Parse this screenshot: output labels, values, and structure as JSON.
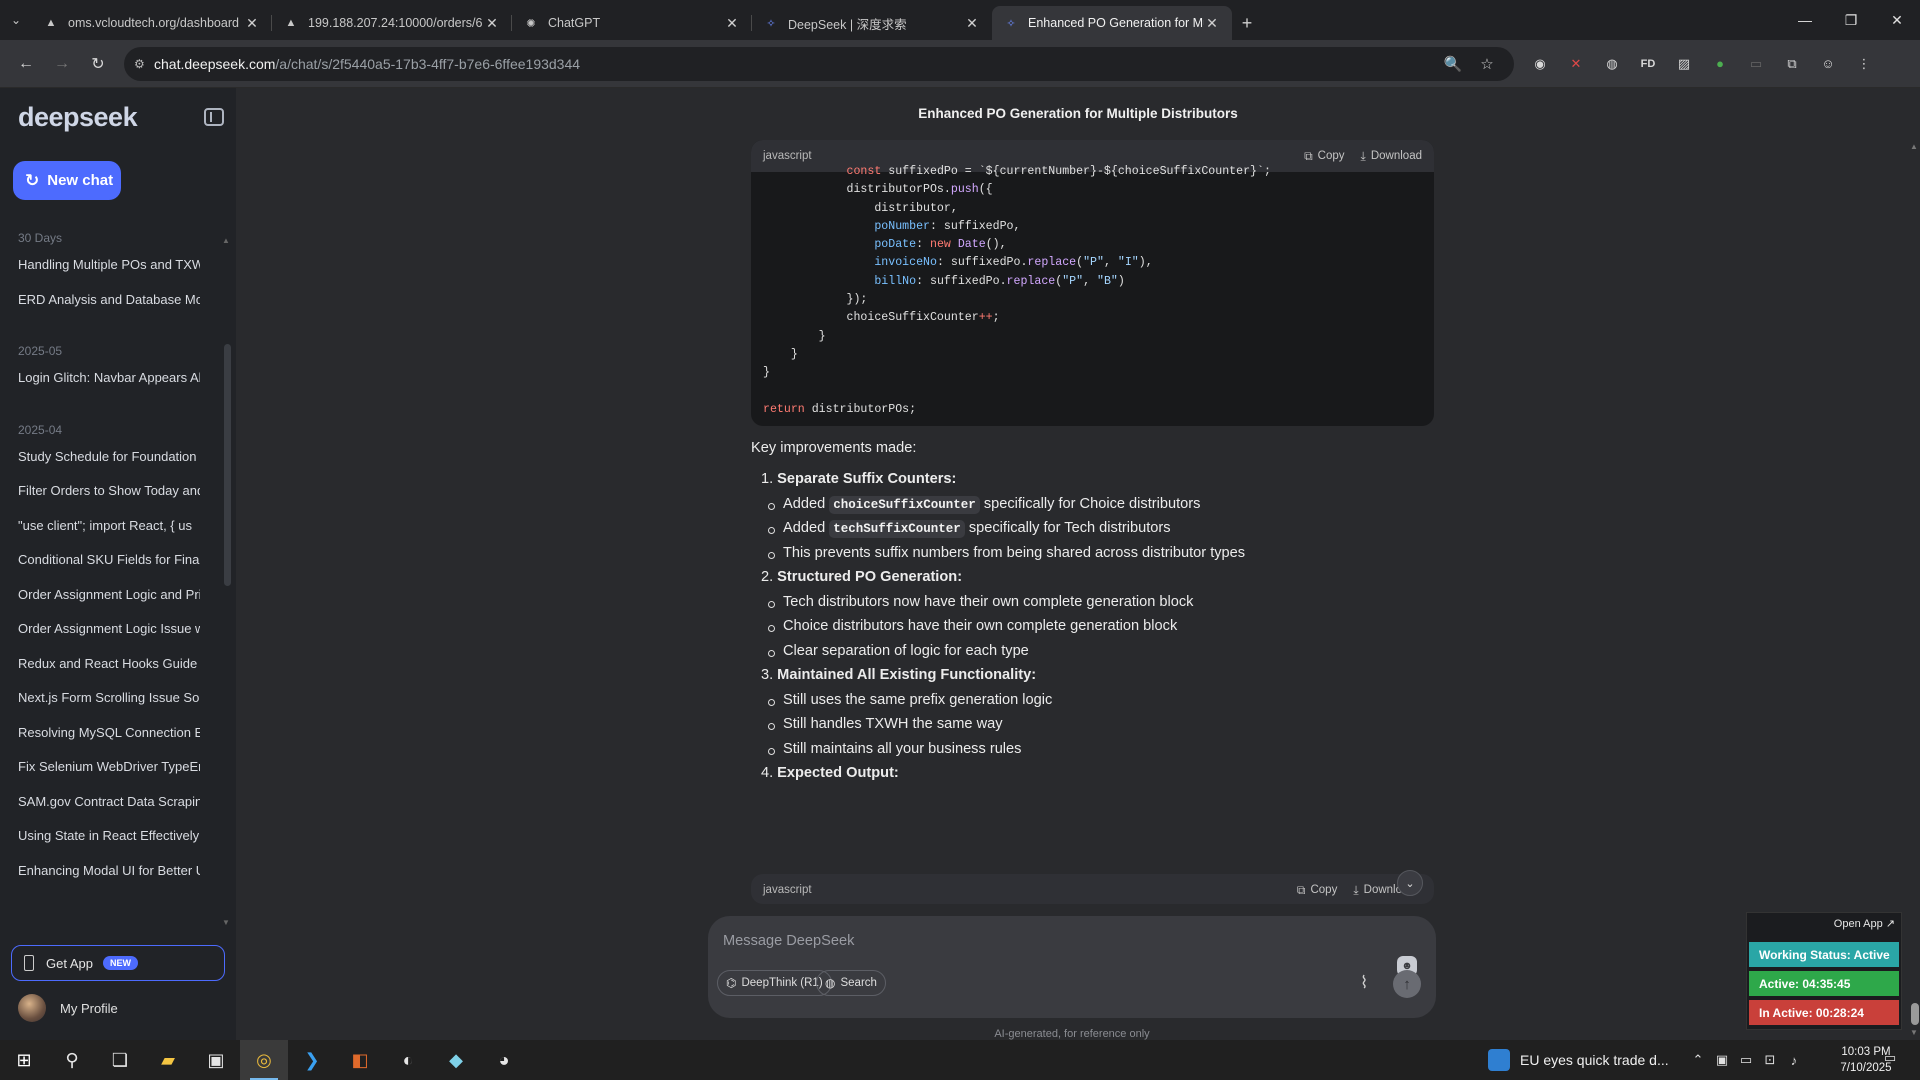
{
  "browser": {
    "tabs": [
      {
        "label": "oms.vcloudtech.org/dashboard",
        "icon": "triangle-icon"
      },
      {
        "label": "199.188.207.24:10000/orders/6",
        "icon": "triangle-icon"
      },
      {
        "label": "ChatGPT",
        "icon": "chatgpt-icon"
      },
      {
        "label": "DeepSeek | 深度求索",
        "icon": "deepseek-icon"
      },
      {
        "label": "Enhanced PO Generation for Mu",
        "icon": "deepseek-icon",
        "active": true
      }
    ],
    "url_host": "chat.deepseek.com",
    "url_path": "/a/chat/s/2f5440a5-17b3-4ff7-b7e6-6ffee193d344"
  },
  "sidebar": {
    "logo": "deepseek",
    "new_chat": "New chat",
    "groups": [
      {
        "label": "30 Days",
        "items": [
          "Handling Multiple POs and TXW",
          "ERD Analysis and Database Mod"
        ]
      },
      {
        "label": "2025-05",
        "items": [
          "Login Glitch: Navbar Appears Ab"
        ]
      },
      {
        "label": "2025-04",
        "items": [
          "Study Schedule for Foundation U",
          "Filter Orders to Show Today and",
          "\"use client\"; import React, { us",
          "Conditional SKU Fields for Finan",
          "Order Assignment Logic and Pri",
          "Order Assignment Logic Issue w",
          "Redux and React Hooks Guide w",
          "Next.js Form Scrolling Issue Solu",
          "Resolving MySQL Connection Er",
          "Fix Selenium WebDriver TypeErr",
          "SAM.gov Contract Data Scraping",
          "Using State in React Effectively",
          "Enhancing Modal UI for Better U"
        ]
      }
    ],
    "get_app": "Get App",
    "new_badge": "NEW",
    "profile": "My Profile"
  },
  "main": {
    "title": "Enhanced PO Generation for Multiple Distributors",
    "code1": {
      "lang": "javascript",
      "copy": "Copy",
      "download": "Download",
      "lines": [
        "            const suffixedPo = `${currentNumber}-${choiceSuffixCounter}`;",
        "            distributorPOs.push({",
        "                distributor,",
        "                poNumber: suffixedPo,",
        "                poDate: new Date(),",
        "                invoiceNo: suffixedPo.replace(\"P\", \"I\"),",
        "                billNo: suffixedPo.replace(\"P\", \"B\")",
        "            });",
        "            choiceSuffixCounter++;",
        "        }",
        "    }",
        "}",
        "",
        "return distributorPOs;"
      ]
    },
    "intro": "Key improvements made:",
    "sections": [
      {
        "num": "1.",
        "heading": "Separate Suffix Counters:",
        "bullets": [
          {
            "pre": "Added ",
            "code": "choiceSuffixCounter",
            "post": " specifically for Choice distributors"
          },
          {
            "pre": "Added ",
            "code": "techSuffixCounter",
            "post": " specifically for Tech distributors"
          },
          {
            "pre": "This prevents suffix numbers from being shared across distributor types",
            "code": "",
            "post": ""
          }
        ]
      },
      {
        "num": "2.",
        "heading": "Structured PO Generation:",
        "bullets": [
          {
            "pre": "Tech distributors now have their own complete generation block",
            "code": "",
            "post": ""
          },
          {
            "pre": "Choice distributors have their own complete generation block",
            "code": "",
            "post": ""
          },
          {
            "pre": "Clear separation of logic for each type",
            "code": "",
            "post": ""
          }
        ]
      },
      {
        "num": "3.",
        "heading": "Maintained All Existing Functionality:",
        "bullets": [
          {
            "pre": "Still uses the same prefix generation logic",
            "code": "",
            "post": ""
          },
          {
            "pre": "Still handles TXWH the same way",
            "code": "",
            "post": ""
          },
          {
            "pre": "Still maintains all your business rules",
            "code": "",
            "post": ""
          }
        ]
      },
      {
        "num": "4.",
        "heading": "Expected Output:",
        "bullets": []
      }
    ],
    "code2": {
      "lang": "javascript",
      "copy": "Copy",
      "download": "Downlo"
    },
    "composer": {
      "placeholder": "Message DeepSeek",
      "deepthink": "DeepThink (R1)",
      "search": "Search"
    },
    "disclaimer": "AI-generated, for reference only"
  },
  "widget": {
    "open_app": "Open App ↗",
    "working": "Working Status: Active",
    "active": "Active: 04:35:45",
    "inactive": "In Active: 00:28:24",
    "colors": {
      "working": "#2aa6a6",
      "active": "#2ea84a",
      "inactive": "#c9403a"
    }
  },
  "taskbar": {
    "news": "EU eyes quick trade d...",
    "time": "10:03 PM",
    "date": "7/10/2025"
  }
}
